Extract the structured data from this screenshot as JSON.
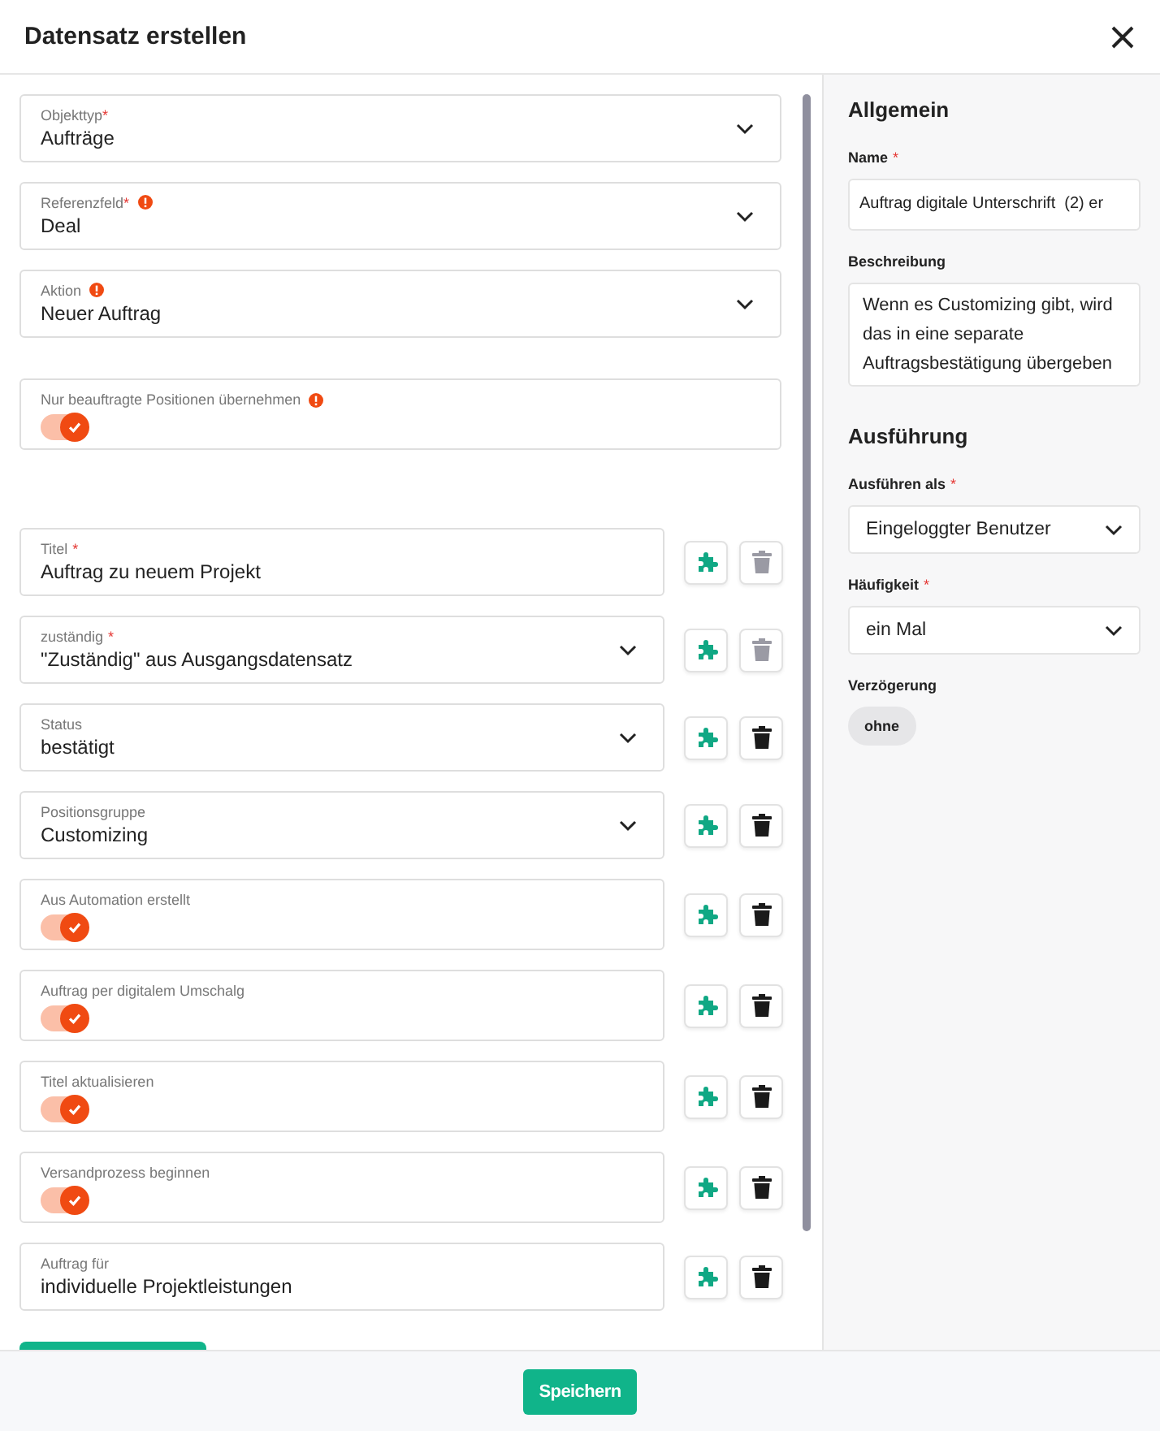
{
  "dialog": {
    "title": "Datensatz erstellen"
  },
  "fields": [
    {
      "kind": "select",
      "label": "Objekttyp",
      "required_mark": "*",
      "info": false,
      "value": "Aufträge"
    },
    {
      "kind": "select",
      "label": "Referenzfeld",
      "required_mark": "*",
      "info": true,
      "value": "Deal"
    },
    {
      "kind": "select",
      "label": "Aktion",
      "info": true,
      "value": "Neuer Auftrag"
    },
    {
      "kind": "toggle",
      "label": "Nur beauftragte Positionen übernehmen",
      "info": true,
      "on": true
    }
  ],
  "mapped_fields": [
    {
      "kind": "text",
      "label": "Titel",
      "required_mark": "*",
      "value": "Auftrag zu neuem Projekt",
      "delete_disabled": true
    },
    {
      "kind": "select",
      "label": "zuständig",
      "required_mark": "*",
      "value": "\"Zuständig\" aus Ausgangsdatensatz",
      "delete_disabled": true
    },
    {
      "kind": "select",
      "label": "Status",
      "value": "bestätigt",
      "delete_disabled": false
    },
    {
      "kind": "select",
      "label": "Positionsgruppe",
      "value": "Customizing",
      "delete_disabled": false
    },
    {
      "kind": "toggle",
      "label": "Aus Automation erstellt",
      "on": true,
      "delete_disabled": false
    },
    {
      "kind": "toggle",
      "label": "Auftrag per digitalem Umschalg",
      "on": true,
      "delete_disabled": false
    },
    {
      "kind": "toggle",
      "label": "Titel aktualisieren",
      "on": true,
      "delete_disabled": false
    },
    {
      "kind": "toggle",
      "label": "Versandprozess beginnen",
      "on": true,
      "delete_disabled": false
    },
    {
      "kind": "text",
      "label": "Auftrag für",
      "value": "individuelle Projektleistungen",
      "delete_disabled": false
    }
  ],
  "settings": [
    {
      "kind": "heading",
      "text": "Allgemein"
    },
    {
      "kind": "input",
      "label": "Name",
      "required_mark": "*",
      "value": "Auftrag digitale Unterschrift  (2) er"
    },
    {
      "kind": "textarea",
      "label": "Beschreibung",
      "value": "Wenn es Customizing gibt, wird das in eine separate Auftragsbestätigung übergeben"
    },
    {
      "kind": "heading",
      "text": "Ausführung"
    },
    {
      "kind": "select",
      "label": "Ausführen als",
      "required_mark": "*",
      "value": "Eingeloggter Benutzer"
    },
    {
      "kind": "select",
      "label": "Häufigkeit",
      "required_mark": "*",
      "value": "ein Mal"
    },
    {
      "kind": "chip",
      "label": "Verzögerung",
      "value": "ohne"
    }
  ],
  "footer": {
    "save_button": "Speichern"
  }
}
